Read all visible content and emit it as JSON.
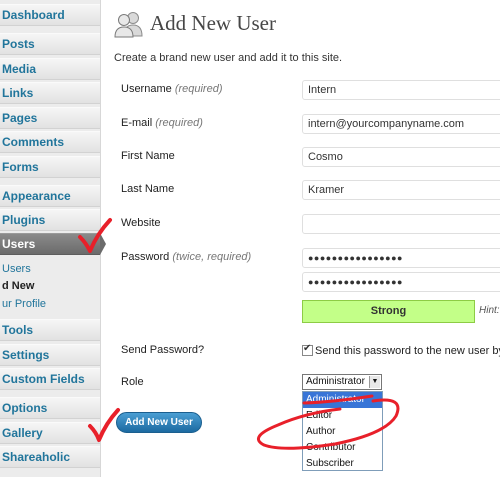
{
  "sidebar": {
    "items": [
      {
        "label": "Dashboard"
      },
      {
        "label": "Posts"
      },
      {
        "label": "Media"
      },
      {
        "label": "Links"
      },
      {
        "label": "Pages"
      },
      {
        "label": "Comments"
      },
      {
        "label": "Forms"
      },
      {
        "label": "Appearance"
      },
      {
        "label": "Plugins"
      },
      {
        "label": "Users"
      },
      {
        "label": "Tools"
      },
      {
        "label": "Settings"
      },
      {
        "label": "Custom Fields"
      },
      {
        "label": "Options"
      },
      {
        "label": "Gallery"
      },
      {
        "label": "Shareaholic"
      }
    ],
    "users_submenu": [
      {
        "label": "Users"
      },
      {
        "label": "d New"
      },
      {
        "label": "ur Profile"
      }
    ]
  },
  "header": {
    "icon": "users-icon",
    "title": "Add New User",
    "description": "Create a brand new user and add it to this site."
  },
  "form": {
    "username_label": "Username",
    "username_req": "(required)",
    "username_value": "Intern",
    "email_label": "E-mail",
    "email_req": "(required)",
    "email_value": "intern@yourcompanyname.com",
    "first_name_label": "First Name",
    "first_name_value": "Cosmo",
    "last_name_label": "Last Name",
    "last_name_value": "Kramer",
    "website_label": "Website",
    "website_value": "",
    "password_label": "Password",
    "password_req": "(twice, required)",
    "password_value": "●●●●●●●●●●●●●●●●",
    "password_confirm_value": "●●●●●●●●●●●●●●●●",
    "strength_label": "Strong",
    "hint_text": "Hint:",
    "send_password_label": "Send Password?",
    "send_password_checked": true,
    "send_password_text": "Send this password to the new user by er",
    "role_label": "Role",
    "role_selected": "Administrator",
    "role_options": [
      "Administrator",
      "Editor",
      "Author",
      "Contributor",
      "Subscriber"
    ],
    "submit_label": "Add New User"
  },
  "colors": {
    "accent": "#21759b",
    "strength_bg": "#c3ff88",
    "annotation_red": "#e8202a",
    "button_blue": "#2a80b9"
  }
}
